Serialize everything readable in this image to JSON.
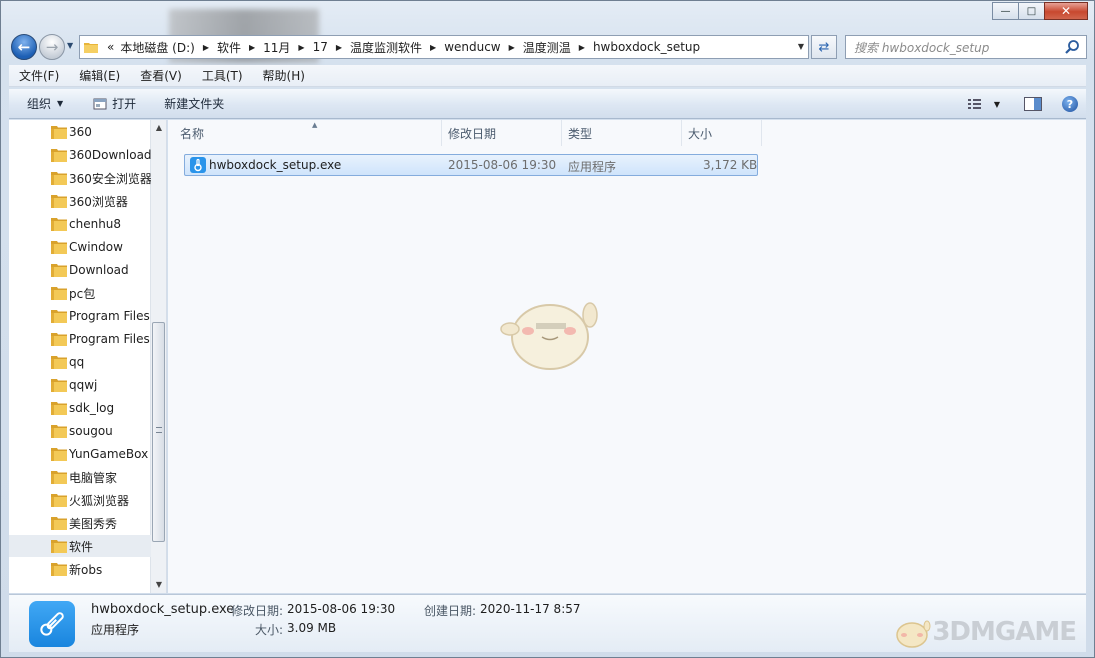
{
  "window": {
    "minimize_glyph": "—",
    "maximize_glyph": "□",
    "close_glyph": "✕"
  },
  "address_bar": {
    "overflow": "«",
    "crumbs": [
      "本地磁盘 (D:)",
      "软件",
      "11月",
      "17",
      "温度监测软件",
      "wenducw",
      "温度测温",
      "hwboxdock_setup"
    ]
  },
  "search": {
    "placeholder": "搜索 hwboxdock_setup"
  },
  "menubar": [
    "文件(F)",
    "编辑(E)",
    "查看(V)",
    "工具(T)",
    "帮助(H)"
  ],
  "toolbar": {
    "organize": "组织",
    "open": "打开",
    "new_folder": "新建文件夹",
    "help": "?"
  },
  "nav_tree": [
    "360",
    "360Download",
    "360安全浏览器",
    "360浏览器",
    "chenhu8",
    "Cwindow",
    "Download",
    "pc包",
    "Program Files",
    "Program Files",
    "qq",
    "qqwj",
    "sdk_log",
    "sougou",
    "YunGameBox",
    "电脑管家",
    "火狐浏览器",
    "美图秀秀",
    "软件",
    "新obs"
  ],
  "nav_selected_index": 18,
  "columns": {
    "name": "名称",
    "modified": "修改日期",
    "type": "类型",
    "size": "大小"
  },
  "files": [
    {
      "name": "hwboxdock_setup.exe",
      "modified": "2015-08-06 19:30",
      "type": "应用程序",
      "size": "3,172 KB"
    }
  ],
  "details": {
    "filename": "hwboxdock_setup.exe",
    "type": "应用程序",
    "modified_label": "修改日期:",
    "modified": "2015-08-06 19:30",
    "created_label": "创建日期:",
    "created": "2020-11-17 8:57",
    "size_label": "大小:",
    "size": "3.09 MB"
  },
  "watermark": "3DMGAME",
  "colors": {
    "selection": "#cfe4fb",
    "accent": "#1985de",
    "folder": "#e8b53a"
  }
}
